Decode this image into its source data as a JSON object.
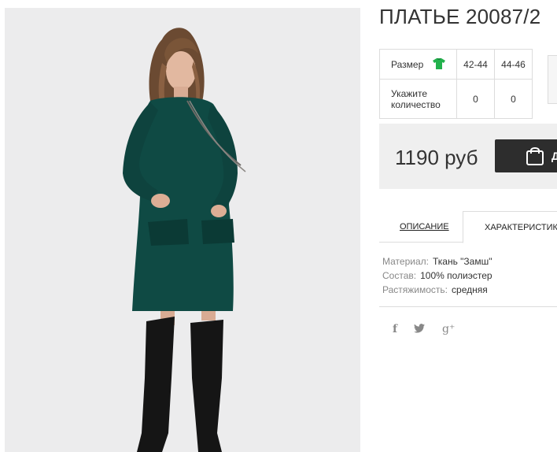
{
  "product": {
    "title": "ПЛАТЬЕ 20087/2",
    "photo_icon": "dress-photo"
  },
  "sizes": {
    "header_label": "Размер",
    "header_icon": "tshirt-icon",
    "size_options": [
      "42-44",
      "44-46"
    ],
    "quantity_label_line1": "Укажите",
    "quantity_label_line2": "количество",
    "quantities": [
      "0",
      "0"
    ]
  },
  "price": {
    "value": "1190 руб",
    "buy_label": "Д",
    "buy_icon": "shopping-bag-icon",
    "accent_color": "#2d2d2d"
  },
  "tabs": [
    {
      "label": "ОПИСАНИЕ",
      "active": false
    },
    {
      "label": "ХАРАКТЕРИСТИКИ",
      "active": true
    }
  ],
  "specs": [
    {
      "label": "Материал:",
      "value": "Ткань \"Замш\""
    },
    {
      "label": "Состав:",
      "value": "100% полиэстер"
    },
    {
      "label": "Растяжимость:",
      "value": "средняя"
    }
  ],
  "social": [
    {
      "icon": "facebook-icon",
      "glyph": "f"
    },
    {
      "icon": "twitter-icon",
      "glyph": "🐦"
    },
    {
      "icon": "google-plus-icon",
      "glyph": "g⁺"
    }
  ]
}
